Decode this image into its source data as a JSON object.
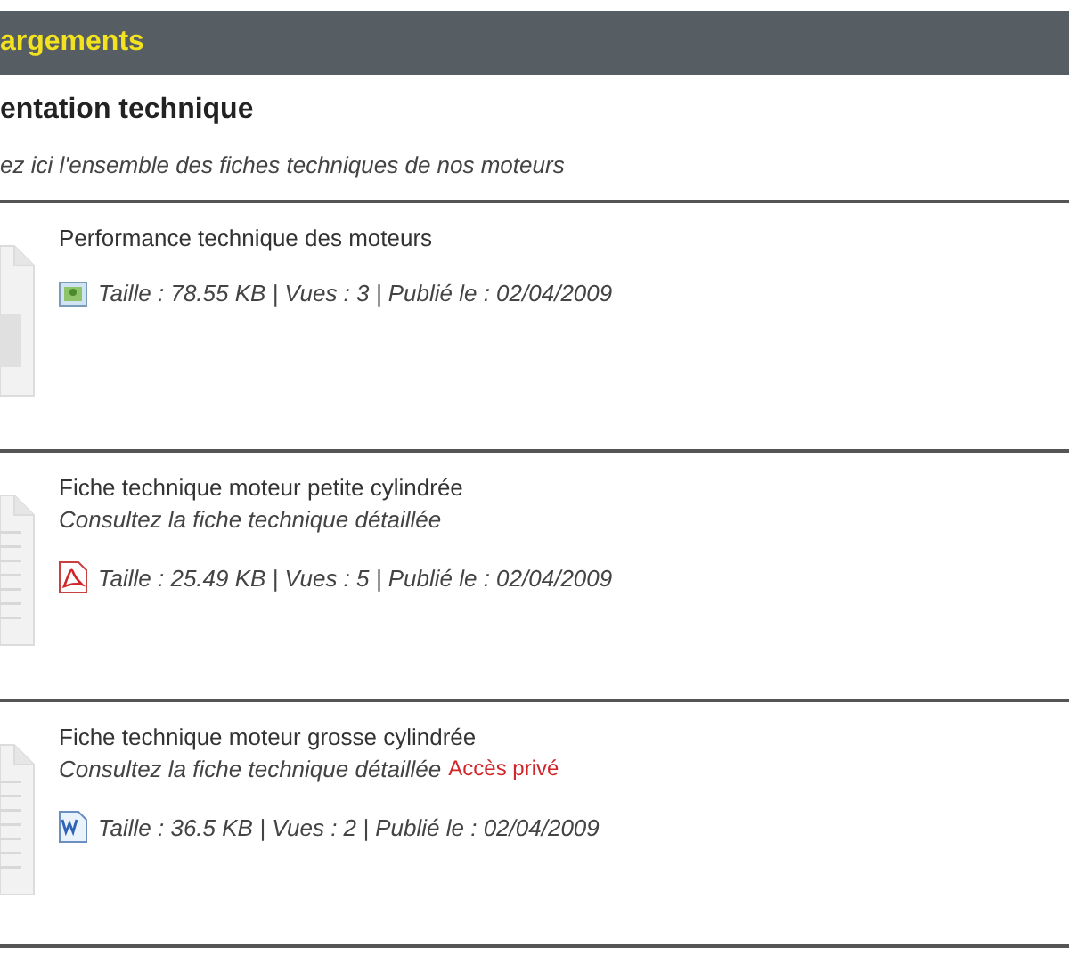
{
  "header": {
    "title": "argements"
  },
  "section": {
    "title": "entation technique",
    "description": "ez ici l'ensemble des fiches techniques de nos moteurs"
  },
  "documents": [
    {
      "thumbnail": {
        "kind": "image"
      },
      "title": "Performance technique des moteurs",
      "file_icon": {
        "kind": "image"
      },
      "meta": "Taille : 78.55 KB | Vues : 3 | Publié le : 02/04/2009"
    },
    {
      "thumbnail": {
        "kind": "text"
      },
      "title": "Fiche technique moteur petite cylindrée",
      "summary": "Consultez la fiche technique détaillée",
      "file_icon": {
        "kind": "pdf"
      },
      "meta": "Taille : 25.49 KB | Vues : 5 | Publié le : 02/04/2009"
    },
    {
      "thumbnail": {
        "kind": "text"
      },
      "title": "Fiche technique moteur grosse cylindrée",
      "summary": "Consultez la fiche technique détaillée",
      "access": "Accès privé",
      "file_icon": {
        "kind": "word"
      },
      "meta": "Taille : 36.5 KB | Vues : 2 | Publié le : 02/04/2009"
    }
  ]
}
